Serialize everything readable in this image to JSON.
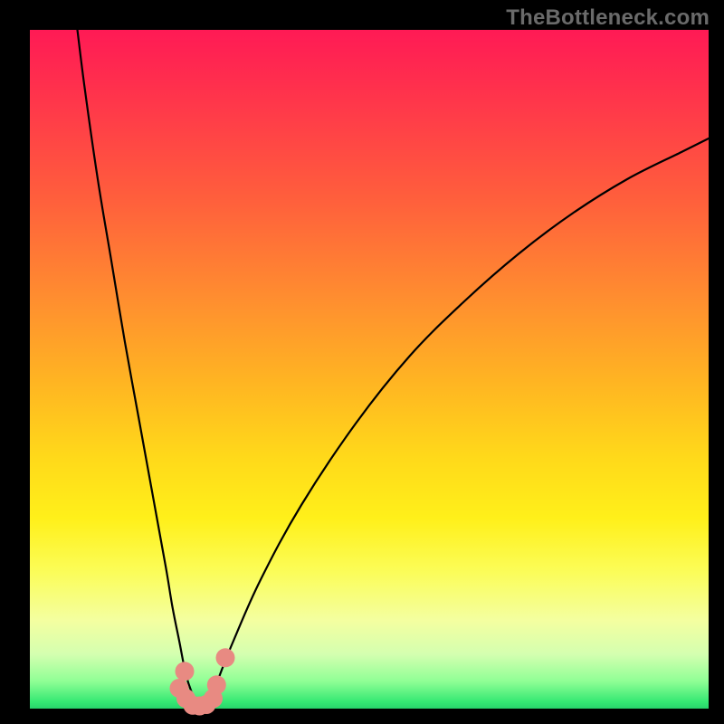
{
  "watermark": "TheBottleneck.com",
  "colors": {
    "background": "#000000",
    "gradient_top": "#ff1a55",
    "gradient_mid1": "#ff8f2f",
    "gradient_mid2": "#ffe81a",
    "gradient_bottom": "#27d36b",
    "curve": "#000000",
    "marker_fill": "#e88a82",
    "marker_stroke": "#d6766f"
  },
  "chart_data": {
    "type": "line",
    "title": "",
    "xlabel": "",
    "ylabel": "",
    "xlim": [
      0,
      100
    ],
    "ylim": [
      0,
      100
    ],
    "series": [
      {
        "name": "bottleneck-curve",
        "x": [
          7,
          8,
          10,
          12,
          14,
          16,
          18,
          20,
          21,
          22,
          23,
          24,
          25,
          26,
          27,
          28,
          30,
          34,
          40,
          48,
          56,
          64,
          72,
          80,
          88,
          96,
          100
        ],
        "y": [
          100,
          92,
          78,
          66,
          54,
          43,
          32,
          21,
          15,
          10,
          5,
          2,
          0,
          0,
          2,
          5,
          10,
          19,
          30,
          42,
          52,
          60,
          67,
          73,
          78,
          82,
          84
        ]
      }
    ],
    "markers": {
      "name": "bottom-cluster",
      "points": [
        {
          "x": 22.0,
          "y": 3.0
        },
        {
          "x": 22.8,
          "y": 5.5
        },
        {
          "x": 23.0,
          "y": 1.5
        },
        {
          "x": 24.0,
          "y": 0.5
        },
        {
          "x": 25.0,
          "y": 0.4
        },
        {
          "x": 26.0,
          "y": 0.6
        },
        {
          "x": 27.0,
          "y": 1.5
        },
        {
          "x": 27.5,
          "y": 3.5
        },
        {
          "x": 28.8,
          "y": 7.5
        }
      ],
      "radius_pct": 1.4
    }
  }
}
